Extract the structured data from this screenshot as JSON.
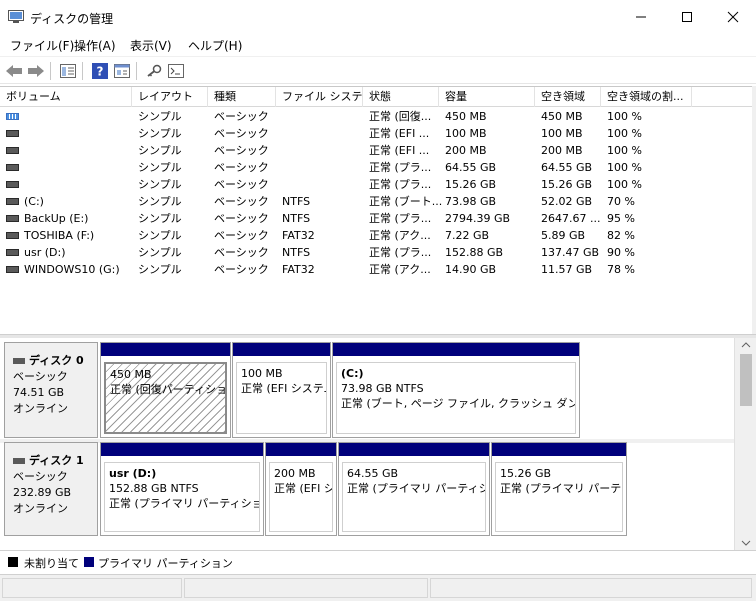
{
  "window": {
    "title": "ディスクの管理",
    "minimize_glyph": "—",
    "maximize_glyph": "☐",
    "close_glyph": "✕"
  },
  "menu": [
    {
      "label": "ファイル(F)"
    },
    {
      "label": "操作(A)"
    },
    {
      "label": "表示(V)"
    },
    {
      "label": "ヘルプ(H)"
    }
  ],
  "toolbar_icons": [
    "back-arrow-icon",
    "forward-arrow-icon",
    "list-view-icon",
    "help-icon",
    "properties-icon",
    "key-icon",
    "console-icon"
  ],
  "columns": [
    "ボリューム",
    "レイアウト",
    "種類",
    "ファイル システム",
    "状態",
    "容量",
    "空き領域",
    "空き領域の割..."
  ],
  "volumes": [
    {
      "name": "",
      "layout": "シンプル",
      "type": "ベーシック",
      "fs": "",
      "status": "正常 (回復...",
      "capacity": "450 MB",
      "free": "450 MB",
      "pct": "100 %"
    },
    {
      "name": "",
      "layout": "シンプル",
      "type": "ベーシック",
      "fs": "",
      "status": "正常 (EFI ...",
      "capacity": "100 MB",
      "free": "100 MB",
      "pct": "100 %"
    },
    {
      "name": "",
      "layout": "シンプル",
      "type": "ベーシック",
      "fs": "",
      "status": "正常 (EFI ...",
      "capacity": "200 MB",
      "free": "200 MB",
      "pct": "100 %"
    },
    {
      "name": "",
      "layout": "シンプル",
      "type": "ベーシック",
      "fs": "",
      "status": "正常 (プラ...",
      "capacity": "64.55 GB",
      "free": "64.55 GB",
      "pct": "100 %"
    },
    {
      "name": "",
      "layout": "シンプル",
      "type": "ベーシック",
      "fs": "",
      "status": "正常 (プラ...",
      "capacity": "15.26 GB",
      "free": "15.26 GB",
      "pct": "100 %"
    },
    {
      "name": "(C:)",
      "layout": "シンプル",
      "type": "ベーシック",
      "fs": "NTFS",
      "status": "正常 (ブート...",
      "capacity": "73.98 GB",
      "free": "52.02 GB",
      "pct": "70 %"
    },
    {
      "name": "BackUp (E:)",
      "layout": "シンプル",
      "type": "ベーシック",
      "fs": "NTFS",
      "status": "正常 (プラ...",
      "capacity": "2794.39 GB",
      "free": "2647.67 ...",
      "pct": "95 %"
    },
    {
      "name": "TOSHIBA (F:)",
      "layout": "シンプル",
      "type": "ベーシック",
      "fs": "FAT32",
      "status": "正常 (アク...",
      "capacity": "7.22 GB",
      "free": "5.89 GB",
      "pct": "82 %"
    },
    {
      "name": "usr (D:)",
      "layout": "シンプル",
      "type": "ベーシック",
      "fs": "NTFS",
      "status": "正常 (プラ...",
      "capacity": "152.88 GB",
      "free": "137.47 GB",
      "pct": "90 %"
    },
    {
      "name": "WINDOWS10 (G:)",
      "layout": "シンプル",
      "type": "ベーシック",
      "fs": "FAT32",
      "status": "正常 (アク...",
      "capacity": "14.90 GB",
      "free": "11.57 GB",
      "pct": "78 %"
    }
  ],
  "disks": [
    {
      "name": "ディスク 0",
      "type": "ベーシック",
      "size": "74.51 GB",
      "state": "オンライン",
      "partitions": [
        {
          "label": "",
          "size": "450 MB",
          "status": "正常 (回復パーティション)"
        },
        {
          "label": "",
          "size": "100 MB",
          "status": "正常 (EFI システム パーティション)"
        },
        {
          "label": "(C:)",
          "size": "73.98 GB NTFS",
          "status": "正常 (ブート, ページ ファイル, クラッシュ ダンプ, プライマリ パーティション)"
        }
      ]
    },
    {
      "name": "ディスク 1",
      "type": "ベーシック",
      "size": "232.89 GB",
      "state": "オンライン",
      "partitions": [
        {
          "label": "usr  (D:)",
          "size": "152.88 GB NTFS",
          "status": "正常 (プライマリ パーティション)"
        },
        {
          "label": "",
          "size": "200 MB",
          "status": "正常 (EFI システム パーティション)"
        },
        {
          "label": "",
          "size": "64.55 GB",
          "status": "正常 (プライマリ パーティション)"
        },
        {
          "label": "",
          "size": "15.26 GB",
          "status": "正常 (プライマリ パーティション)"
        }
      ]
    }
  ],
  "legend": [
    {
      "label": "未割り当て",
      "color": "#000000"
    },
    {
      "label": "プライマリ パーティション",
      "color": "#00007b"
    }
  ],
  "colors": {
    "primary_partition": "#00007b",
    "unallocated": "#000000"
  }
}
